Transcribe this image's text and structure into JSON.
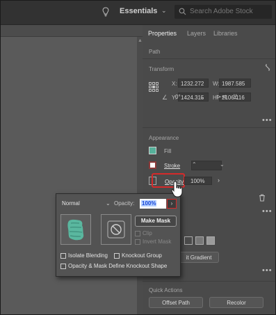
{
  "topbar": {
    "workspace_label": "Essentials",
    "search_placeholder": "Search Adobe Stock"
  },
  "panel": {
    "tabs": [
      {
        "label": "Properties",
        "active": true
      },
      {
        "label": "Layers",
        "active": false
      },
      {
        "label": "Libraries",
        "active": false
      }
    ],
    "selection_type": "Path",
    "transform": {
      "section_label": "Transform",
      "x_label": "X:",
      "x_value": "1232.272",
      "y_label": "Y:",
      "y_value": "1424.315",
      "w_label": "W:",
      "w_value": "1987.585",
      "h_label": "H:",
      "h_value": "2106.116",
      "angle_value": "0°"
    },
    "appearance": {
      "section_label": "Appearance",
      "fill_label": "Fill",
      "stroke_label": "Stroke",
      "opacity_label": "Opacity",
      "opacity_value": "100%"
    },
    "buttons": {
      "gradient_partial_label": "it Gradient"
    },
    "quick_actions": {
      "section_label": "Quick Actions",
      "offset_path_label": "Offset Path",
      "recolor_label": "Recolor"
    }
  },
  "popup": {
    "blend_mode": "Normal",
    "opacity_label": "Opacity:",
    "opacity_value": "100%",
    "make_mask_label": "Make Mask",
    "clip_label": "Clip",
    "invert_mask_label": "Invert Mask",
    "isolate_blending_label": "Isolate Blending",
    "knockout_group_label": "Knockout Group",
    "opacity_mask_define_label": "Opacity & Mask Define Knockout Shape"
  },
  "colors": {
    "fill_swatch": "#56b09a",
    "highlight_ring": "#d62a2a"
  }
}
